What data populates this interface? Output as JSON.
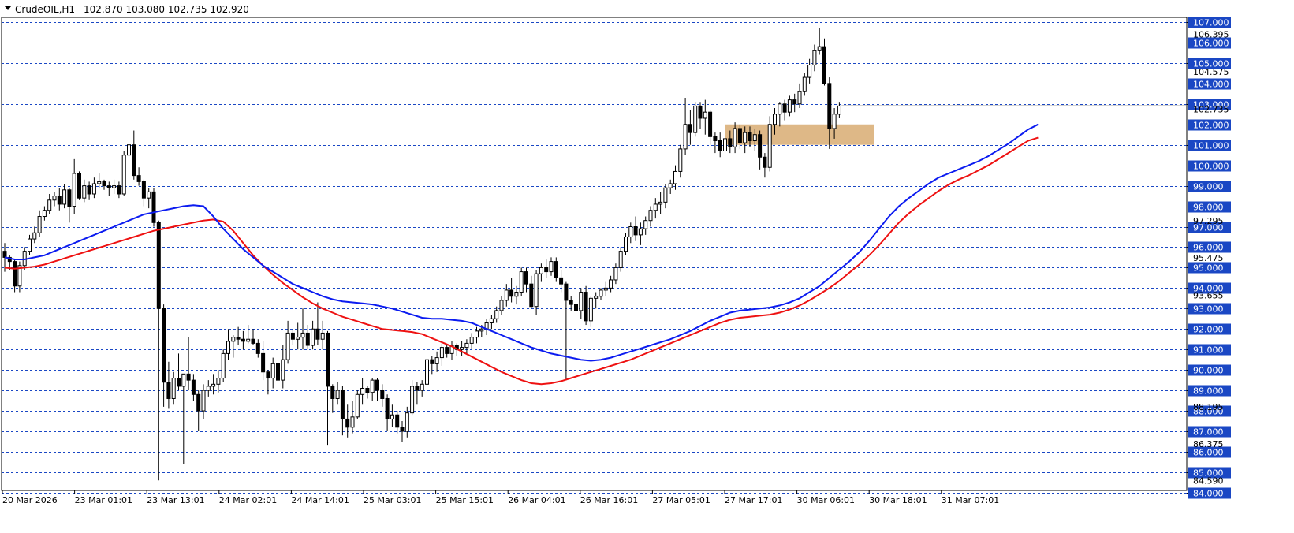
{
  "header": {
    "symbol": "CrudeOIL,H1",
    "ohlc": "102.870 103.080 102.735 102.920",
    "menu_icon": "triangle-down-icon"
  },
  "colors": {
    "bg": "#ffffff",
    "grid": "#1a47c4",
    "ma_fast": "#0b1bf0",
    "ma_slow": "#ee1111",
    "zone": "#deb887",
    "label_bg": "#1a47c4",
    "candle": "#000000"
  },
  "chart_data": {
    "type": "candlestick",
    "title": "CrudeOIL,H1",
    "ylim": [
      84,
      107.5
    ],
    "grid": true,
    "y_ticks": [
      "107.000",
      "106.000",
      "105.000",
      "104.000",
      "103.000",
      "102.000",
      "101.000",
      "100.000",
      "99.000",
      "98.000",
      "97.000",
      "96.000",
      "95.000",
      "94.000",
      "93.000",
      "92.000",
      "91.000",
      "90.000",
      "89.000",
      "88.000",
      "87.000",
      "86.000",
      "85.000",
      "84.000"
    ],
    "y_extra_labels": [
      "106.395",
      "104.575",
      "102.735",
      "97.295",
      "95.475",
      "93.655",
      "88.195",
      "86.375",
      "84.590"
    ],
    "x_labels": [
      "20 Mar 2026",
      "23 Mar 01:01",
      "23 Mar 13:01",
      "24 Mar 02:01",
      "24 Mar 14:01",
      "25 Mar 03:01",
      "25 Mar 15:01",
      "26 Mar 04:01",
      "26 Mar 16:01",
      "27 Mar 05:01",
      "27 Mar 17:01",
      "30 Mar 06:01",
      "30 Mar 18:01",
      "31 Mar 07:01"
    ],
    "ohlc": [
      [
        95.8,
        96.2,
        94.8,
        95.5
      ],
      [
        95.5,
        95.6,
        94.9,
        95.3
      ],
      [
        95.3,
        95.4,
        93.8,
        94.1
      ],
      [
        94.1,
        95.3,
        93.8,
        95.1
      ],
      [
        95.1,
        96.0,
        94.9,
        95.8
      ],
      [
        95.8,
        96.6,
        95.6,
        96.4
      ],
      [
        96.4,
        97.0,
        96.2,
        96.7
      ],
      [
        96.7,
        97.8,
        96.5,
        97.5
      ],
      [
        97.5,
        98.0,
        97.3,
        97.8
      ],
      [
        97.8,
        98.6,
        97.6,
        98.3
      ],
      [
        98.3,
        98.7,
        98.0,
        98.5
      ],
      [
        98.5,
        98.9,
        97.8,
        98.1
      ],
      [
        98.1,
        99.1,
        97.9,
        98.8
      ],
      [
        98.8,
        98.9,
        97.2,
        98.0
      ],
      [
        98.0,
        100.3,
        97.6,
        99.6
      ],
      [
        99.6,
        99.7,
        98.3,
        98.4
      ],
      [
        98.4,
        99.3,
        98.2,
        99.0
      ],
      [
        99.0,
        99.2,
        98.3,
        98.6
      ],
      [
        98.6,
        99.4,
        98.4,
        99.1
      ],
      [
        99.1,
        99.6,
        98.9,
        99.2
      ],
      [
        99.2,
        99.3,
        98.8,
        99.0
      ],
      [
        99.0,
        99.2,
        98.5,
        98.9
      ],
      [
        98.9,
        99.3,
        98.6,
        99.0
      ],
      [
        99.0,
        99.2,
        98.4,
        98.6
      ],
      [
        98.6,
        100.7,
        98.5,
        100.5
      ],
      [
        100.5,
        101.6,
        100.3,
        101.0
      ],
      [
        101.0,
        101.7,
        99.3,
        99.5
      ],
      [
        99.5,
        99.9,
        99.0,
        99.2
      ],
      [
        99.2,
        99.3,
        98.0,
        98.4
      ],
      [
        98.4,
        98.9,
        97.9,
        98.7
      ],
      [
        98.7,
        98.9,
        97.0,
        97.2
      ],
      [
        97.2,
        97.3,
        84.6,
        93.0
      ],
      [
        93.0,
        93.2,
        88.2,
        89.4
      ],
      [
        89.4,
        90.4,
        88.1,
        88.6
      ],
      [
        88.6,
        89.9,
        88.3,
        89.6
      ],
      [
        89.6,
        90.8,
        89.0,
        89.2
      ],
      [
        89.2,
        89.6,
        85.4,
        89.8
      ],
      [
        89.8,
        91.6,
        89.0,
        89.5
      ],
      [
        89.5,
        89.8,
        88.5,
        88.8
      ],
      [
        88.8,
        89.0,
        87.0,
        88.0
      ],
      [
        88.0,
        89.3,
        87.6,
        89.0
      ],
      [
        89.0,
        89.5,
        88.7,
        89.2
      ],
      [
        89.2,
        89.8,
        88.8,
        89.3
      ],
      [
        89.3,
        90.0,
        88.9,
        89.6
      ],
      [
        89.6,
        91.0,
        89.4,
        90.8
      ],
      [
        90.8,
        92.0,
        90.5,
        91.4
      ],
      [
        91.4,
        91.7,
        90.6,
        91.6
      ],
      [
        91.6,
        92.1,
        91.2,
        91.5
      ],
      [
        91.5,
        91.9,
        91.0,
        91.4
      ],
      [
        91.4,
        92.2,
        91.3,
        91.5
      ],
      [
        91.5,
        92.0,
        91.2,
        91.3
      ],
      [
        91.3,
        91.5,
        90.6,
        90.8
      ],
      [
        90.8,
        91.4,
        89.5,
        89.9
      ],
      [
        89.9,
        90.0,
        88.8,
        89.6
      ],
      [
        89.6,
        90.6,
        89.1,
        90.3
      ],
      [
        90.3,
        90.5,
        89.3,
        89.5
      ],
      [
        89.5,
        91.2,
        89.1,
        90.5
      ],
      [
        90.5,
        92.4,
        90.3,
        91.8
      ],
      [
        91.8,
        92.0,
        91.2,
        91.5
      ],
      [
        91.5,
        92.3,
        91.0,
        91.6
      ],
      [
        91.6,
        93.0,
        91.0,
        91.8
      ],
      [
        91.8,
        92.2,
        91.0,
        91.2
      ],
      [
        91.2,
        92.4,
        91.0,
        92.0
      ],
      [
        92.0,
        93.3,
        91.2,
        91.5
      ],
      [
        91.5,
        92.4,
        91.0,
        91.8
      ],
      [
        91.8,
        91.9,
        86.3,
        89.2
      ],
      [
        89.2,
        89.3,
        87.9,
        88.6
      ],
      [
        88.6,
        89.4,
        88.3,
        89.0
      ],
      [
        89.0,
        89.2,
        86.8,
        87.6
      ],
      [
        87.6,
        88.3,
        86.7,
        87.2
      ],
      [
        87.2,
        88.5,
        86.9,
        87.7
      ],
      [
        87.7,
        89.0,
        87.6,
        88.8
      ],
      [
        88.8,
        89.6,
        88.3,
        89.1
      ],
      [
        89.1,
        89.2,
        88.6,
        88.9
      ],
      [
        88.9,
        89.6,
        88.5,
        89.5
      ],
      [
        89.5,
        89.6,
        88.5,
        89.0
      ],
      [
        89.0,
        89.3,
        88.2,
        88.6
      ],
      [
        88.6,
        88.8,
        87.0,
        87.6
      ],
      [
        87.6,
        88.3,
        87.2,
        87.8
      ],
      [
        87.8,
        88.0,
        86.9,
        87.2
      ],
      [
        87.2,
        87.5,
        86.5,
        87.0
      ],
      [
        87.0,
        88.2,
        86.7,
        87.9
      ],
      [
        87.9,
        89.5,
        87.8,
        89.2
      ],
      [
        89.2,
        89.4,
        88.3,
        89.0
      ],
      [
        89.0,
        89.5,
        88.7,
        89.3
      ],
      [
        89.3,
        90.8,
        89.0,
        90.5
      ],
      [
        90.5,
        90.7,
        89.8,
        90.3
      ],
      [
        90.3,
        90.9,
        89.9,
        90.6
      ],
      [
        90.6,
        91.3,
        90.2,
        91.1
      ],
      [
        91.1,
        91.2,
        90.6,
        90.8
      ],
      [
        90.8,
        91.4,
        90.5,
        91.2
      ],
      [
        91.2,
        91.3,
        90.7,
        91.0
      ],
      [
        91.0,
        91.4,
        90.7,
        91.1
      ],
      [
        91.1,
        91.5,
        90.8,
        91.3
      ],
      [
        91.3,
        91.8,
        91.0,
        91.6
      ],
      [
        91.6,
        92.1,
        91.3,
        91.9
      ],
      [
        91.9,
        92.2,
        91.6,
        92.0
      ],
      [
        92.0,
        92.5,
        91.7,
        92.3
      ],
      [
        92.3,
        92.7,
        92.0,
        92.5
      ],
      [
        92.5,
        93.1,
        92.3,
        92.9
      ],
      [
        92.9,
        93.6,
        92.7,
        93.4
      ],
      [
        93.4,
        94.2,
        93.1,
        93.9
      ],
      [
        93.9,
        94.5,
        93.3,
        93.6
      ],
      [
        93.6,
        94.1,
        93.2,
        93.8
      ],
      [
        93.8,
        95.0,
        93.6,
        94.8
      ],
      [
        94.8,
        95.0,
        93.8,
        94.2
      ],
      [
        94.2,
        94.6,
        93.0,
        93.1
      ],
      [
        93.1,
        94.9,
        92.7,
        94.7
      ],
      [
        94.7,
        95.2,
        94.3,
        95.0
      ],
      [
        95.0,
        95.4,
        94.5,
        94.8
      ],
      [
        94.8,
        95.5,
        94.6,
        95.3
      ],
      [
        95.3,
        95.5,
        94.3,
        94.5
      ],
      [
        94.5,
        94.9,
        93.8,
        94.2
      ],
      [
        94.2,
        94.3,
        89.5,
        93.4
      ],
      [
        93.4,
        93.6,
        92.9,
        93.2
      ],
      [
        93.2,
        93.5,
        92.6,
        92.9
      ],
      [
        92.9,
        94.0,
        92.5,
        93.8
      ],
      [
        93.8,
        94.1,
        92.2,
        92.4
      ],
      [
        92.4,
        93.6,
        92.1,
        93.5
      ],
      [
        93.5,
        93.8,
        93.0,
        93.6
      ],
      [
        93.6,
        94.0,
        93.4,
        93.9
      ],
      [
        93.9,
        94.3,
        93.6,
        94.0
      ],
      [
        94.0,
        94.6,
        93.8,
        94.4
      ],
      [
        94.4,
        95.2,
        94.2,
        95.0
      ],
      [
        95.0,
        96.0,
        94.8,
        95.8
      ],
      [
        95.8,
        96.7,
        95.6,
        96.5
      ],
      [
        96.5,
        97.2,
        96.2,
        97.0
      ],
      [
        97.0,
        97.5,
        96.3,
        96.6
      ],
      [
        96.6,
        97.2,
        96.1,
        96.9
      ],
      [
        96.9,
        97.5,
        96.6,
        97.3
      ],
      [
        97.3,
        98.0,
        97.0,
        97.8
      ],
      [
        97.8,
        98.4,
        97.4,
        98.1
      ],
      [
        98.1,
        98.7,
        97.6,
        98.2
      ],
      [
        98.2,
        99.1,
        97.9,
        98.9
      ],
      [
        98.9,
        99.3,
        98.6,
        99.1
      ],
      [
        99.1,
        100.0,
        98.8,
        99.7
      ],
      [
        99.7,
        101.0,
        99.4,
        100.8
      ],
      [
        100.8,
        103.3,
        100.5,
        102.0
      ],
      [
        102.0,
        102.7,
        101.0,
        101.6
      ],
      [
        101.6,
        103.1,
        101.4,
        102.9
      ],
      [
        102.9,
        103.1,
        101.8,
        102.3
      ],
      [
        102.3,
        103.2,
        101.5,
        102.6
      ],
      [
        102.6,
        102.7,
        101.0,
        101.4
      ],
      [
        101.4,
        101.6,
        100.6,
        101.2
      ],
      [
        101.2,
        101.6,
        100.4,
        100.7
      ],
      [
        100.7,
        101.5,
        100.5,
        101.3
      ],
      [
        101.3,
        101.7,
        100.6,
        100.9
      ],
      [
        100.9,
        102.1,
        100.6,
        101.8
      ],
      [
        101.8,
        102.0,
        100.8,
        101.1
      ],
      [
        101.1,
        101.9,
        100.6,
        101.6
      ],
      [
        101.6,
        101.9,
        100.9,
        101.2
      ],
      [
        101.2,
        101.8,
        100.7,
        101.5
      ],
      [
        101.5,
        101.7,
        99.8,
        100.4
      ],
      [
        100.4,
        100.6,
        99.4,
        99.9
      ],
      [
        99.9,
        102.4,
        99.7,
        102.0
      ],
      [
        102.0,
        102.8,
        101.5,
        102.5
      ],
      [
        102.5,
        103.1,
        101.9,
        103.0
      ],
      [
        103.0,
        103.2,
        102.2,
        102.6
      ],
      [
        102.6,
        103.4,
        102.4,
        103.2
      ],
      [
        103.2,
        103.5,
        102.6,
        103.0
      ],
      [
        103.0,
        104.0,
        102.8,
        103.6
      ],
      [
        103.6,
        104.5,
        103.4,
        104.3
      ],
      [
        104.3,
        105.2,
        104.0,
        104.9
      ],
      [
        104.9,
        105.9,
        104.6,
        105.6
      ],
      [
        105.6,
        106.7,
        105.4,
        105.8
      ],
      [
        105.8,
        106.2,
        103.9,
        104.0
      ],
      [
        104.0,
        104.3,
        100.8,
        101.8
      ],
      [
        101.8,
        102.8,
        101.3,
        102.5
      ],
      [
        102.5,
        103.1,
        102.3,
        102.9
      ]
    ],
    "ma_fast": [
      95.5,
      95.4,
      95.4,
      95.5,
      95.6,
      95.8,
      96.0,
      96.2,
      96.4,
      96.6,
      96.8,
      97.0,
      97.2,
      97.4,
      97.6,
      97.7,
      97.8,
      97.9,
      98.0,
      98.05,
      98.0,
      97.5,
      96.9,
      96.4,
      95.9,
      95.5,
      95.1,
      94.8,
      94.5,
      94.2,
      94.0,
      93.8,
      93.6,
      93.45,
      93.35,
      93.3,
      93.25,
      93.2,
      93.1,
      93.0,
      92.85,
      92.7,
      92.55,
      92.5,
      92.5,
      92.45,
      92.4,
      92.3,
      92.1,
      91.9,
      91.7,
      91.5,
      91.3,
      91.1,
      90.95,
      90.8,
      90.7,
      90.6,
      90.5,
      90.45,
      90.5,
      90.6,
      90.75,
      90.9,
      91.05,
      91.2,
      91.35,
      91.5,
      91.7,
      91.9,
      92.15,
      92.4,
      92.6,
      92.8,
      92.9,
      92.95,
      93.0,
      93.05,
      93.15,
      93.3,
      93.5,
      93.8,
      94.1,
      94.5,
      94.9,
      95.3,
      95.75,
      96.3,
      96.9,
      97.5,
      98.0,
      98.4,
      98.75,
      99.1,
      99.4,
      99.6,
      99.8,
      100.0,
      100.2,
      100.45,
      100.75,
      101.05,
      101.4,
      101.75,
      102.0
    ],
    "ma_slow": [
      95.0,
      94.95,
      95.0,
      95.05,
      95.15,
      95.3,
      95.45,
      95.6,
      95.75,
      95.9,
      96.05,
      96.2,
      96.35,
      96.5,
      96.65,
      96.8,
      96.9,
      97.0,
      97.1,
      97.2,
      97.3,
      97.35,
      97.25,
      96.8,
      96.2,
      95.6,
      95.1,
      94.65,
      94.25,
      93.9,
      93.55,
      93.25,
      93.0,
      92.8,
      92.6,
      92.45,
      92.3,
      92.15,
      92.0,
      91.95,
      91.9,
      91.85,
      91.75,
      91.55,
      91.35,
      91.15,
      90.9,
      90.65,
      90.4,
      90.15,
      89.9,
      89.7,
      89.5,
      89.35,
      89.3,
      89.35,
      89.45,
      89.6,
      89.75,
      89.9,
      90.05,
      90.2,
      90.35,
      90.5,
      90.7,
      90.9,
      91.1,
      91.3,
      91.5,
      91.7,
      91.9,
      92.1,
      92.3,
      92.45,
      92.55,
      92.6,
      92.65,
      92.7,
      92.8,
      92.95,
      93.15,
      93.4,
      93.7,
      94.0,
      94.35,
      94.75,
      95.15,
      95.6,
      96.1,
      96.65,
      97.2,
      97.65,
      98.05,
      98.4,
      98.75,
      99.05,
      99.3,
      99.5,
      99.75,
      100.0,
      100.3,
      100.6,
      100.9,
      101.2,
      101.35
    ]
  },
  "zone": {
    "from_bar": 145,
    "to_bar": 175,
    "low": 101.0,
    "high": 102.0
  },
  "price_label": "102.920"
}
